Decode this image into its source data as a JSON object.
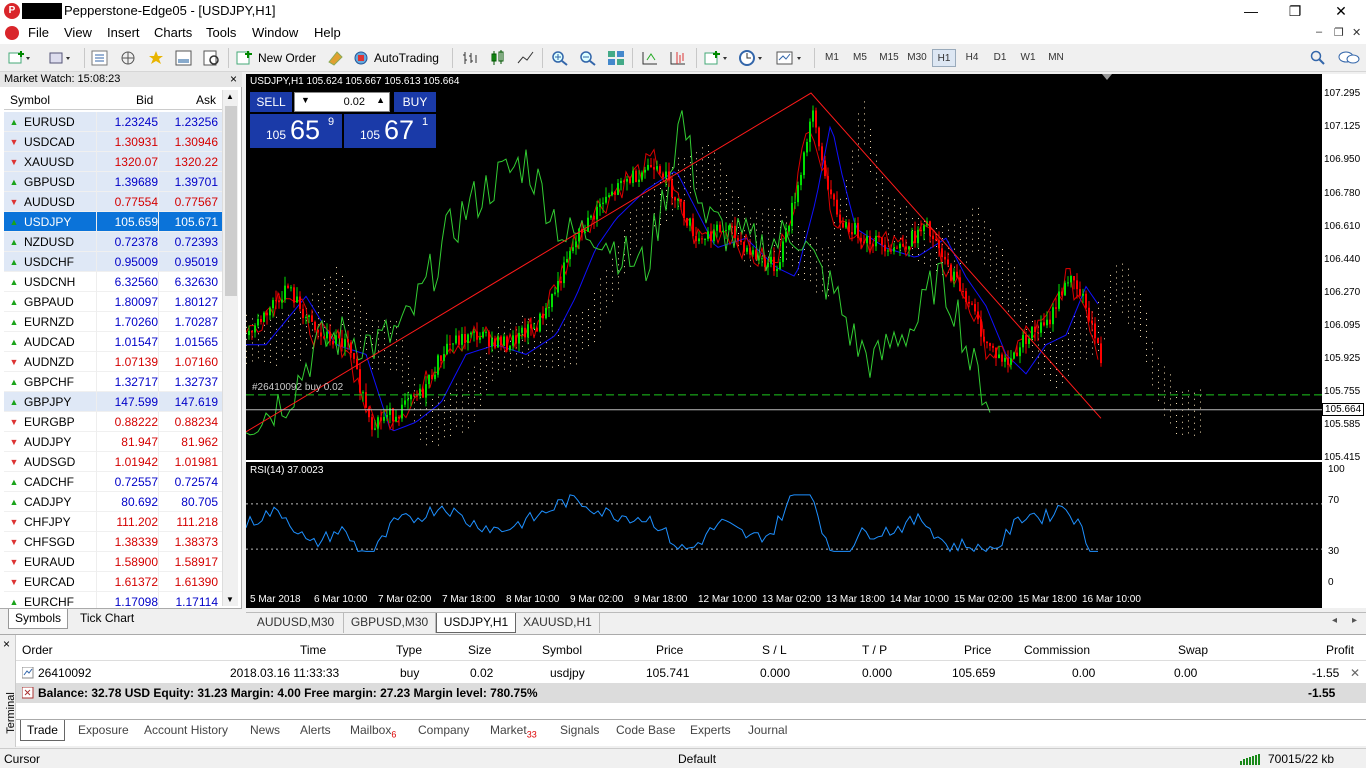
{
  "window": {
    "title": "Pepperstone-Edge05 - [USDJPY,H1]",
    "app_logo": "P",
    "minimize": "—",
    "maximize": "❐",
    "close": "✕"
  },
  "menu": {
    "items": [
      "File",
      "View",
      "Insert",
      "Charts",
      "Tools",
      "Window",
      "Help"
    ],
    "mdi_controls": [
      "–",
      "❐",
      "✕"
    ]
  },
  "toolbar": {
    "new_order_label": "New Order",
    "autotrading_label": "AutoTrading",
    "timeframes": [
      "M1",
      "M5",
      "M15",
      "M30",
      "H1",
      "H4",
      "D1",
      "W1",
      "MN"
    ],
    "active_timeframe": "H1"
  },
  "market_watch": {
    "title": "Market Watch: 15:08:23",
    "close": "×",
    "columns": [
      "Symbol",
      "Bid",
      "Ask"
    ],
    "rows": [
      {
        "symbol": "EURUSD",
        "bid": "1.23245",
        "ask": "1.23256",
        "dir": "up"
      },
      {
        "symbol": "USDCAD",
        "bid": "1.30931",
        "ask": "1.30946",
        "dir": "down"
      },
      {
        "symbol": "XAUUSD",
        "bid": "1320.07",
        "ask": "1320.22",
        "dir": "down"
      },
      {
        "symbol": "GBPUSD",
        "bid": "1.39689",
        "ask": "1.39701",
        "dir": "up"
      },
      {
        "symbol": "AUDUSD",
        "bid": "0.77554",
        "ask": "0.77567",
        "dir": "down"
      },
      {
        "symbol": "USDJPY",
        "bid": "105.659",
        "ask": "105.671",
        "dir": "up"
      },
      {
        "symbol": "NZDUSD",
        "bid": "0.72378",
        "ask": "0.72393",
        "dir": "up"
      },
      {
        "symbol": "USDCHF",
        "bid": "0.95009",
        "ask": "0.95019",
        "dir": "up"
      },
      {
        "symbol": "USDCNH",
        "bid": "6.32560",
        "ask": "6.32630",
        "dir": "up"
      },
      {
        "symbol": "GBPAUD",
        "bid": "1.80097",
        "ask": "1.80127",
        "dir": "up"
      },
      {
        "symbol": "EURNZD",
        "bid": "1.70260",
        "ask": "1.70287",
        "dir": "up"
      },
      {
        "symbol": "AUDCAD",
        "bid": "1.01547",
        "ask": "1.01565",
        "dir": "up"
      },
      {
        "symbol": "AUDNZD",
        "bid": "1.07139",
        "ask": "1.07160",
        "dir": "down"
      },
      {
        "symbol": "GBPCHF",
        "bid": "1.32717",
        "ask": "1.32737",
        "dir": "up"
      },
      {
        "symbol": "GBPJPY",
        "bid": "147.599",
        "ask": "147.619",
        "dir": "up"
      },
      {
        "symbol": "EURGBP",
        "bid": "0.88222",
        "ask": "0.88234",
        "dir": "down"
      },
      {
        "symbol": "AUDJPY",
        "bid": "81.947",
        "ask": "81.962",
        "dir": "down"
      },
      {
        "symbol": "AUDSGD",
        "bid": "1.01942",
        "ask": "1.01981",
        "dir": "down"
      },
      {
        "symbol": "CADCHF",
        "bid": "0.72557",
        "ask": "0.72574",
        "dir": "up"
      },
      {
        "symbol": "CADJPY",
        "bid": "80.692",
        "ask": "80.705",
        "dir": "up"
      },
      {
        "symbol": "CHFJPY",
        "bid": "111.202",
        "ask": "111.218",
        "dir": "down"
      },
      {
        "symbol": "CHFSGD",
        "bid": "1.38339",
        "ask": "1.38373",
        "dir": "down"
      },
      {
        "symbol": "EURAUD",
        "bid": "1.58900",
        "ask": "1.58917",
        "dir": "down"
      },
      {
        "symbol": "EURCAD",
        "bid": "1.61372",
        "ask": "1.61390",
        "dir": "down"
      },
      {
        "symbol": "EURCHF",
        "bid": "1.17098",
        "ask": "1.17114",
        "dir": "up"
      }
    ],
    "tabs": [
      "Symbols",
      "Tick Chart"
    ]
  },
  "chart": {
    "header": "USDJPY,H1  105.624 105.667 105.613 105.664",
    "sell_label": "SELL",
    "buy_label": "BUY",
    "volume": "0.02",
    "sell_prefix": "105",
    "sell_big": "65",
    "sell_sup": "9",
    "buy_prefix": "105",
    "buy_big": "67",
    "buy_sup": "1",
    "order_line_label": "#26410092 buy 0.02",
    "current_price_label": "105.664",
    "price_axis": [
      "107.295",
      "107.125",
      "106.950",
      "106.780",
      "106.610",
      "106.440",
      "106.270",
      "106.095",
      "105.925",
      "105.755",
      "105.585",
      "105.415"
    ],
    "rsi_label": "RSI(14) 37.0023",
    "rsi_axis": [
      "100",
      "70",
      "30",
      "0"
    ],
    "time_axis": [
      "5 Mar 2018",
      "6 Mar 10:00",
      "7 Mar 02:00",
      "7 Mar 18:00",
      "8 Mar 10:00",
      "9 Mar 02:00",
      "9 Mar 18:00",
      "12 Mar 10:00",
      "13 Mar 02:00",
      "13 Mar 18:00",
      "14 Mar 10:00",
      "15 Mar 02:00",
      "15 Mar 18:00",
      "16 Mar 10:00"
    ],
    "tabs": [
      "AUDUSD,M30",
      "GBPUSD,M30",
      "USDJPY,H1",
      "XAUUSD,H1"
    ],
    "active_tab": "USDJPY,H1",
    "colors": {
      "bull": "#00e000",
      "bear": "#ff0000",
      "kijun": "#1010ff",
      "chikou": "#32cd32",
      "cloud": "#f5deb3",
      "rsi": "#1e90ff"
    }
  },
  "terminal": {
    "side_label": "Terminal",
    "close": "×",
    "columns": [
      "Order",
      "Time",
      "Type",
      "Size",
      "Symbol",
      "Price",
      "S / L",
      "T / P",
      "Price",
      "Commission",
      "Swap",
      "Profit"
    ],
    "order": {
      "order": "26410092",
      "time": "2018.03.16 11:33:33",
      "type": "buy",
      "size": "0.02",
      "symbol": "usdjpy",
      "price": "105.741",
      "sl": "0.000",
      "tp": "0.000",
      "cur_price": "105.659",
      "commission": "0.00",
      "swap": "0.00",
      "profit": "-1.55"
    },
    "balance_line": "Balance: 32.78 USD  Equity: 31.23  Margin: 4.00  Free margin: 27.23  Margin level: 780.75%",
    "total_profit": "-1.55",
    "tabs": [
      "Trade",
      "Exposure",
      "Account History",
      "News",
      "Alerts",
      "Mailbox",
      "Company",
      "Market",
      "Signals",
      "Code Base",
      "Experts",
      "Journal"
    ],
    "mailbox_badge": "6",
    "market_badge": "33"
  },
  "status": {
    "left": "Cursor",
    "profile": "Default",
    "traffic": "70015/22 kb"
  }
}
